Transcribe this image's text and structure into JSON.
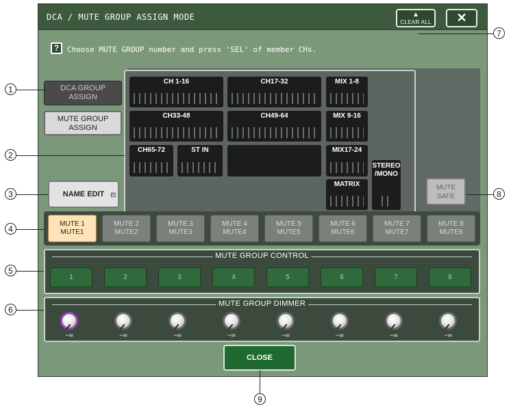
{
  "window": {
    "title": "DCA / MUTE GROUP ASSIGN MODE",
    "clear_all_label": "CLEAR ALL",
    "close_x": "✕",
    "help_glyph": "?",
    "instruction": "Choose MUTE GROUP number and press 'SEL' of member CHs."
  },
  "mode_buttons": [
    {
      "label": "DCA GROUP\nASSIGN",
      "selected": false
    },
    {
      "label": "MUTE GROUP\nASSIGN",
      "selected": true
    }
  ],
  "channel_groups": [
    {
      "label": "CH 1-16"
    },
    {
      "label": "CH17-32"
    },
    {
      "label": "MIX 1-8"
    },
    {
      "label": "CH33-48"
    },
    {
      "label": "CH49-64"
    },
    {
      "label": "MIX 9-16"
    },
    {
      "label": "CH65-72"
    },
    {
      "label": "ST IN"
    },
    {
      "label": "MIX17-24"
    },
    {
      "label": "MATRIX"
    },
    {
      "label": "STEREO\n/MONO"
    }
  ],
  "name_edit_label": "NAME EDIT",
  "mute_safe_label": "MUTE\nSAFE",
  "mute_groups": [
    {
      "line1": "MUTE 1",
      "line2": "MUTE1",
      "selected": true
    },
    {
      "line1": "MUTE 2",
      "line2": "MUTE2",
      "selected": false
    },
    {
      "line1": "MUTE 3",
      "line2": "MUTE3",
      "selected": false
    },
    {
      "line1": "MUTE 4",
      "line2": "MUTE4",
      "selected": false
    },
    {
      "line1": "MUTE 5",
      "line2": "MUTE5",
      "selected": false
    },
    {
      "line1": "MUTE 6",
      "line2": "MUTE6",
      "selected": false
    },
    {
      "line1": "MUTE 7",
      "line2": "MUTE7",
      "selected": false
    },
    {
      "line1": "MUTE 8",
      "line2": "MUTE8",
      "selected": false
    }
  ],
  "control": {
    "title": "MUTE GROUP CONTROL",
    "buttons": [
      "1",
      "2",
      "3",
      "4",
      "5",
      "6",
      "7",
      "8"
    ]
  },
  "dimmer": {
    "title": "MUTE GROUP DIMMER",
    "values": [
      "−∞",
      "−∞",
      "−∞",
      "−∞",
      "−∞",
      "−∞",
      "−∞",
      "−∞"
    ]
  },
  "close_label": "CLOSE",
  "callouts": [
    "1",
    "2",
    "3",
    "4",
    "5",
    "6",
    "7",
    "8",
    "9"
  ],
  "colors": {
    "window_bg": "#7b987b",
    "title_bg": "#3d5a3e",
    "selected_mute": "#ffe3b8",
    "control_button": "#2e6a3a",
    "dimmer_selected_ring": "#9a40c0"
  }
}
